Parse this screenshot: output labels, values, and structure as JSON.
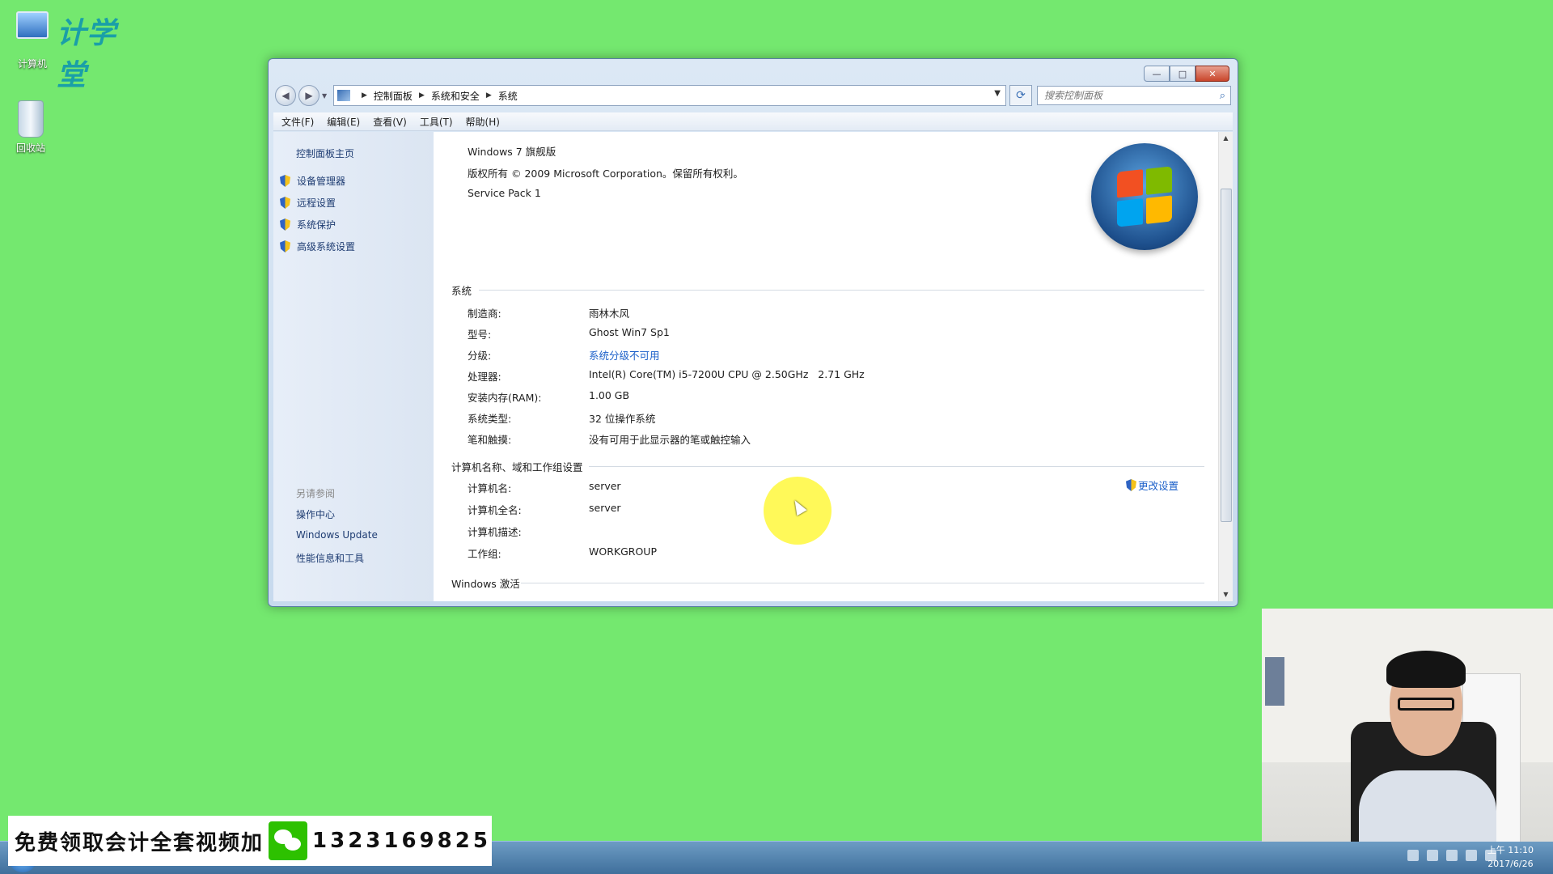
{
  "desktop": {
    "watermark_text": "计学堂",
    "icons": [
      {
        "label": "计算机",
        "icon": "computer-icon"
      },
      {
        "label": "回收站",
        "icon": "recycle-bin-icon"
      }
    ]
  },
  "window": {
    "breadcrumbs": [
      "控制面板",
      "系统和安全",
      "系统"
    ],
    "search_placeholder": "搜索控制面板",
    "caption": {
      "minimize": "—",
      "maximize": "□",
      "close": "✕"
    },
    "menu": [
      "文件(F)",
      "编辑(E)",
      "查看(V)",
      "工具(T)",
      "帮助(H)"
    ],
    "left_pane": {
      "home": "控制面板主页",
      "tasks": [
        "设备管理器",
        "远程设置",
        "系统保护",
        "高级系统设置"
      ],
      "see_also_title": "另请参阅",
      "see_also": [
        "操作中心",
        "Windows Update",
        "性能信息和工具"
      ]
    },
    "edition": {
      "name": "Windows 7 旗舰版",
      "copyright": "版权所有 © 2009 Microsoft Corporation。保留所有权利。",
      "service_pack": "Service Pack 1"
    },
    "system": {
      "title": "系统",
      "rows": [
        {
          "label": "制造商:",
          "value": "雨林木风"
        },
        {
          "label": "型号:",
          "value": "Ghost Win7 Sp1"
        },
        {
          "label": "分级:",
          "value": "系统分级不可用"
        },
        {
          "label": "处理器:",
          "value": "Intel(R) Core(TM) i5-7200U CPU @ 2.50GHz   2.71 GHz"
        },
        {
          "label": "安装内存(RAM):",
          "value": "1.00 GB"
        },
        {
          "label": "系统类型:",
          "value": "32 位操作系统"
        },
        {
          "label": "笔和触摸:",
          "value": "没有可用于此显示器的笔或触控输入"
        }
      ]
    },
    "computer_name": {
      "title": "计算机名称、域和工作组设置",
      "change_link": "更改设置",
      "rows": [
        {
          "label": "计算机名:",
          "value": "server"
        },
        {
          "label": "计算机全名:",
          "value": "server"
        },
        {
          "label": "计算机描述:",
          "value": ""
        },
        {
          "label": "工作组:",
          "value": "WORKGROUP"
        }
      ]
    },
    "activation": {
      "title": "Windows 激活"
    }
  },
  "taskbar": {
    "clock_time": "上午 11:10",
    "clock_date": "2017/6/26"
  },
  "promo": {
    "text": "免费领取会计全套视频加",
    "phone": "13231698​25"
  },
  "colors": {
    "desktop_bg": "#74e86f",
    "link": "#1a5fc9",
    "highlight": "#fff83c"
  }
}
